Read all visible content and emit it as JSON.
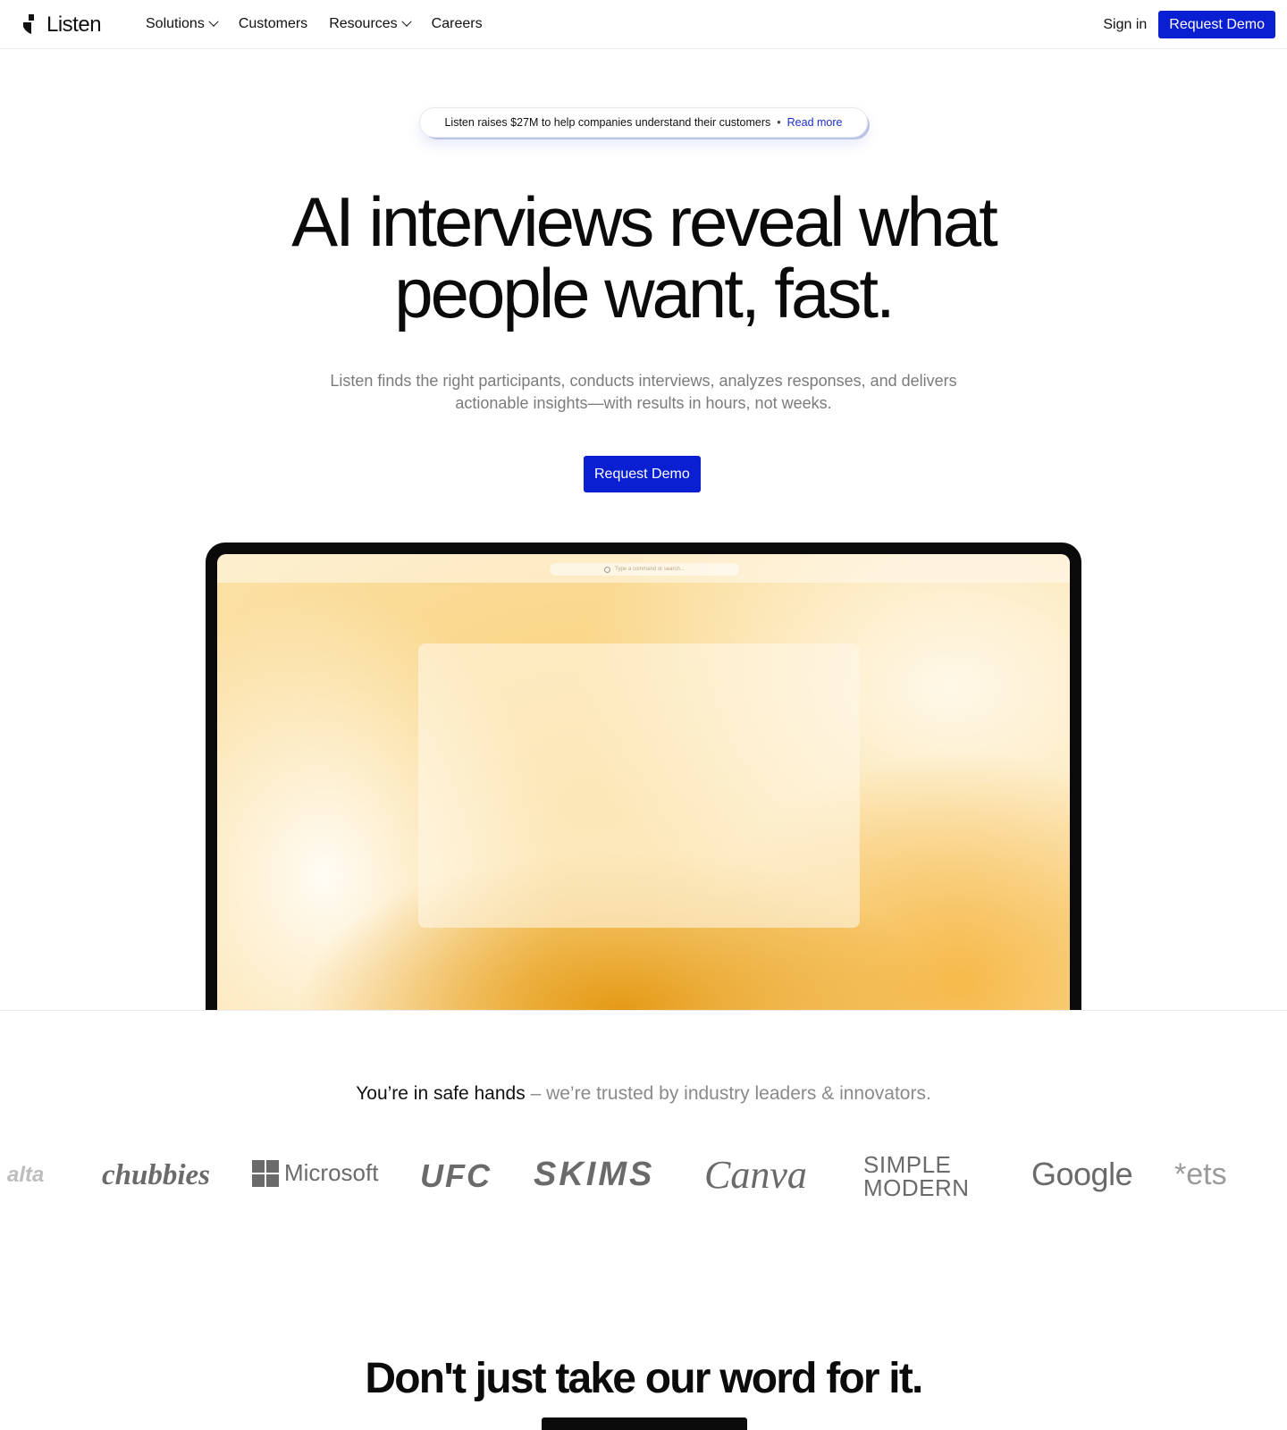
{
  "nav": {
    "brand": "Listen",
    "links": [
      {
        "label": "Solutions",
        "has_dropdown": true
      },
      {
        "label": "Customers",
        "has_dropdown": false
      },
      {
        "label": "Resources",
        "has_dropdown": true
      },
      {
        "label": "Careers",
        "has_dropdown": false
      }
    ],
    "signin": "Sign in",
    "cta": "Request Demo"
  },
  "announcement": {
    "text": "Listen raises $27M to help companies understand their customers",
    "separator": "•",
    "link": "Read more"
  },
  "hero": {
    "title_line1": "AI interviews reveal what",
    "title_line2": "people want, fast.",
    "subtitle_line1": "Listen finds the right participants, conducts interviews, analyzes responses, and delivers",
    "subtitle_line2": "actionable insights—with results in hours, not weeks.",
    "cta": "Request Demo"
  },
  "device": {
    "search_placeholder": "Type a command or search..."
  },
  "trust": {
    "strong": "You’re in safe hands",
    "muted": " – we’re trusted by industry leaders & innovators."
  },
  "logos": {
    "alta": "alta",
    "chubbies": "chubbies",
    "microsoft": "Microsoft",
    "ufc": "UFC",
    "skims": "SKIMS",
    "canva": "Canva",
    "simple_line1": "SIMPLE",
    "simple_line2": "MODERN",
    "google": "Google",
    "ets": "*ets"
  },
  "section2": {
    "title": "Don't just take our word for it."
  },
  "colors": {
    "accent": "#0a1fd1",
    "link": "#1b2fc7",
    "muted_text": "#7b7b7b"
  }
}
